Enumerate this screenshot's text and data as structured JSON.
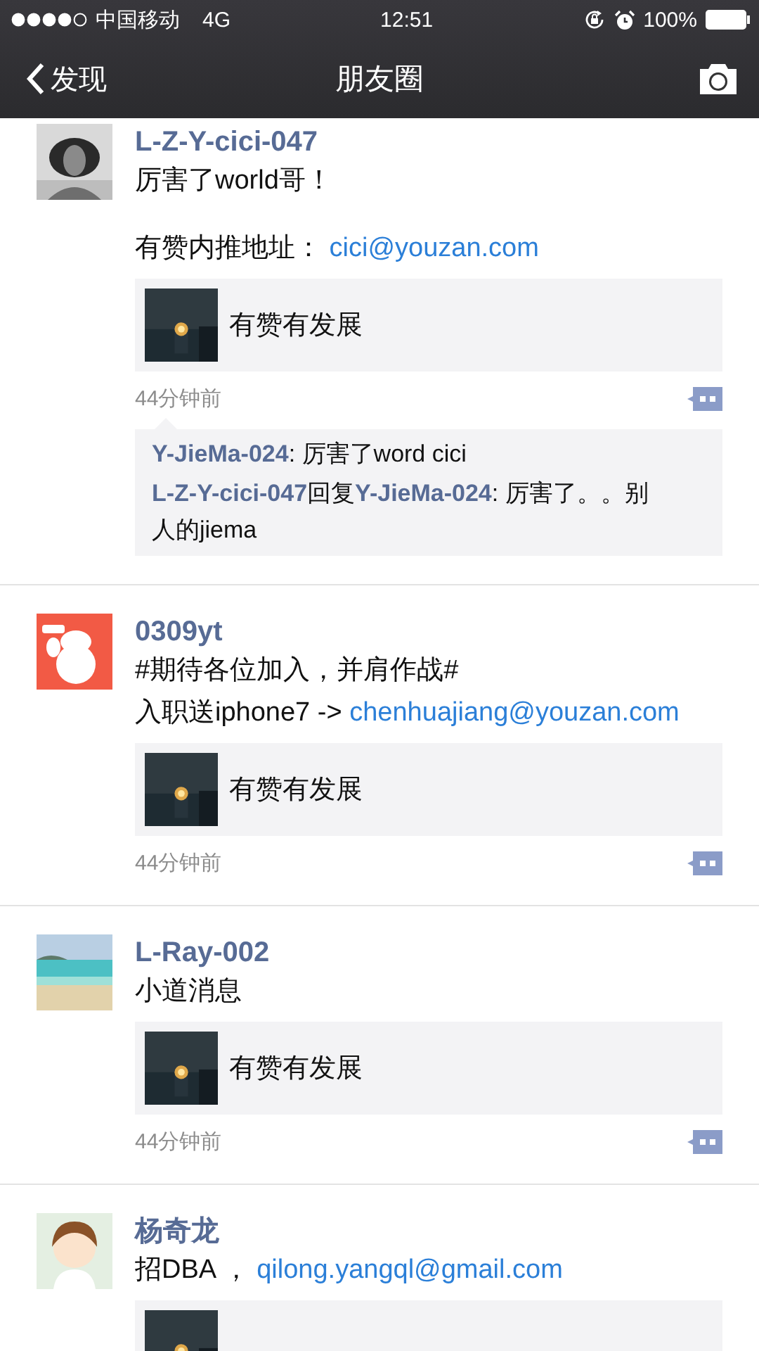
{
  "status_bar": {
    "carrier": "中国移动",
    "network": "4G",
    "time": "12:51",
    "battery": "100%"
  },
  "nav": {
    "back": "发现",
    "title": "朋友圈"
  },
  "posts": [
    {
      "author": "L-Z-Y-cici-047",
      "lines": [
        {
          "kind": "text",
          "segments": [
            {
              "kind": "text",
              "text": "厉害了world哥！"
            }
          ]
        },
        {
          "kind": "spacer"
        },
        {
          "kind": "text",
          "segments": [
            {
              "kind": "text",
              "text": "有赞内推地址： "
            },
            {
              "kind": "link",
              "text": "cici@youzan.com"
            }
          ]
        }
      ],
      "card": {
        "kind": "link",
        "title": "有赞有发展"
      },
      "time": "44分钟前",
      "comments": [
        {
          "segments": [
            {
              "kind": "name",
              "text": "Y-JieMa-024"
            },
            {
              "kind": "text",
              "text": ": 厉害了word cici"
            }
          ]
        },
        {
          "segments": [
            {
              "kind": "name",
              "text": "L-Z-Y-cici-047"
            },
            {
              "kind": "text",
              "text": "回复"
            },
            {
              "kind": "name",
              "text": "Y-JieMa-024"
            },
            {
              "kind": "text",
              "text": ": 厉害了。。别人的jiema"
            }
          ]
        }
      ]
    },
    {
      "author": "0309yt",
      "lines": [
        {
          "kind": "text",
          "segments": [
            {
              "kind": "text",
              "text": "#期待各位加入，并肩作战#"
            }
          ]
        },
        {
          "kind": "text",
          "segments": [
            {
              "kind": "text",
              "text": "入职送iphone7 -> "
            },
            {
              "kind": "link",
              "text": "chenhuajiang@youzan.com"
            }
          ]
        }
      ],
      "card": {
        "kind": "link",
        "title": "有赞有发展"
      },
      "time": "44分钟前"
    },
    {
      "author": "L-Ray-002",
      "lines": [
        {
          "kind": "text",
          "segments": [
            {
              "kind": "text",
              "text": "小道消息"
            }
          ]
        }
      ],
      "card": {
        "kind": "link",
        "title": "有赞有发展"
      },
      "time": "44分钟前"
    },
    {
      "author": "杨奇龙",
      "lines": [
        {
          "kind": "text",
          "segments": [
            {
              "kind": "text",
              "text": "招DBA ， "
            },
            {
              "kind": "link",
              "text": "qilong.yangql@gmail.com"
            }
          ]
        }
      ],
      "card": {
        "kind": "link"
      }
    }
  ]
}
